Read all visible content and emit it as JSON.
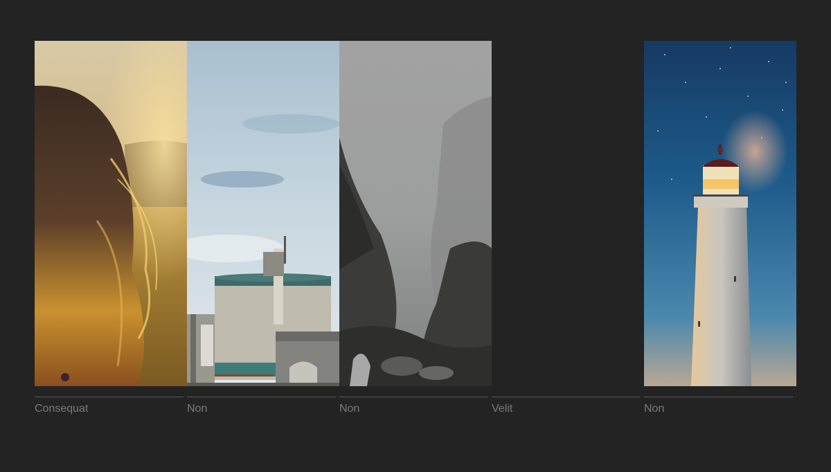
{
  "gallery": {
    "items": [
      {
        "caption": "Consequat",
        "image": "girl-hair-sunlight-field"
      },
      {
        "caption": "Non",
        "image": "industrial-tank-sky"
      },
      {
        "caption": "Non",
        "image": "misty-mountain-gorge"
      },
      {
        "caption": "Velit",
        "image": "empty"
      },
      {
        "caption": "Non",
        "image": "lighthouse-starry-sky"
      }
    ]
  }
}
